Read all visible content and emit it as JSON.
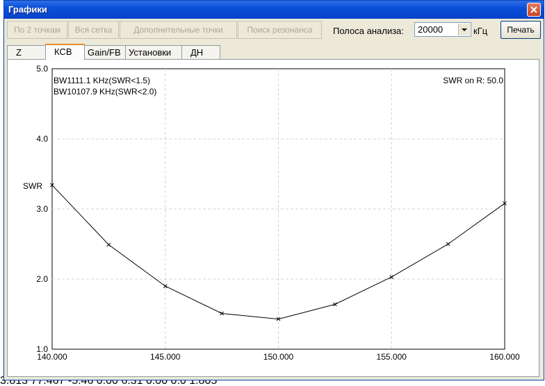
{
  "window": {
    "title": "Графики"
  },
  "toolbar": {
    "buttons": [
      {
        "label": "По 2 точкам"
      },
      {
        "label": "Вся сетка"
      },
      {
        "label": "Дополнительные точки"
      },
      {
        "label": "Поиск резонанса"
      }
    ],
    "band_label": "Полоса анализа:",
    "band_value": "20000",
    "band_unit": "кГц",
    "print_label": "Печать"
  },
  "tabs": [
    {
      "label": "Z"
    },
    {
      "label": "КСВ",
      "selected": true
    },
    {
      "label": "Gain/FB"
    },
    {
      "label": "Установки"
    },
    {
      "label": "ДН"
    }
  ],
  "background_text": "3.813     77.467     -5.46     0.00     6.31     0.00     0.0     1.805",
  "chart_data": {
    "type": "line",
    "ylabel": "SWR",
    "annotations": [
      "BW1111.1 KHz(SWR<1.5)",
      "BW10107.9 KHz(SWR<2.0)"
    ],
    "swr_note": "SWR on R: 50.0",
    "xlim": [
      140,
      160
    ],
    "ylim": [
      1.0,
      5.0
    ],
    "x_ticks": [
      "140.000",
      "145.000",
      "150.000",
      "155.000",
      "160.000"
    ],
    "y_ticks": [
      "1.0",
      "2.0",
      "3.0",
      "4.0",
      "5.0"
    ],
    "x": [
      140.0,
      142.5,
      145.0,
      147.5,
      150.0,
      152.5,
      155.0,
      157.5,
      160.0
    ],
    "y": [
      3.34,
      2.49,
      1.9,
      1.51,
      1.43,
      1.64,
      2.03,
      2.5,
      3.08
    ],
    "grid": true,
    "line_color": "#000000",
    "grid_color": "#d4d4d4"
  }
}
